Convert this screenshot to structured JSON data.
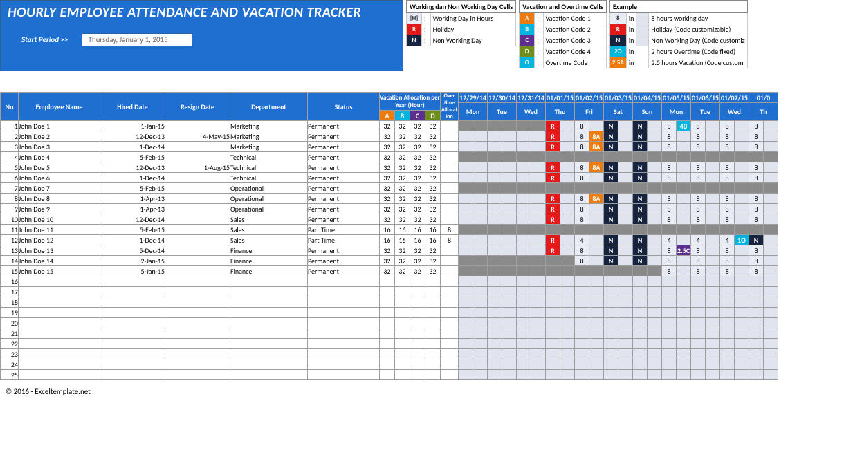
{
  "title": "HOURLY EMPLOYEE ATTENDANCE AND VACATION TRACKER",
  "start_label": "Start Period >>",
  "start_value": "Thursday, January 1, 2015",
  "legend1": {
    "header": "Working dan Non Working Day Cells",
    "rows": [
      {
        "code": "[H]",
        "cls": "lg-h",
        "desc": "Working Day in Hours"
      },
      {
        "code": "R",
        "cls": "lg-r",
        "desc": "Holiday"
      },
      {
        "code": "N",
        "cls": "lg-n",
        "desc": "Non Working Day"
      }
    ]
  },
  "legend2": {
    "header": "Vacation and Overtime Cells",
    "rows": [
      {
        "code": "A",
        "cls": "lg-a",
        "desc": "Vacation Code 1"
      },
      {
        "code": "B",
        "cls": "lg-b",
        "desc": "Vacation Code 2"
      },
      {
        "code": "C",
        "cls": "lg-c",
        "desc": "Vacation Code 3"
      },
      {
        "code": "D",
        "cls": "lg-d",
        "desc": "Vacation Code 4"
      },
      {
        "code": "O",
        "cls": "lg-o",
        "desc": "Overtime Code"
      }
    ]
  },
  "legend3": {
    "header": "Example",
    "rows": [
      {
        "code": "8",
        "cls": "lg-num",
        "in": "in",
        "box": "ltgray",
        "desc": "8 hours working day"
      },
      {
        "code": "R",
        "cls": "lg-r",
        "in": "in",
        "box": "ltgray",
        "desc": "Holiday (Code customizable)"
      },
      {
        "code": "N",
        "cls": "lg-n",
        "in": "in",
        "box": "ltgray",
        "desc": "Non Working Day (Code customiz"
      },
      {
        "code": "2O",
        "cls": "lg-2o",
        "in": "in",
        "box": "",
        "desc": "2 hours Overtime (Code fixed)"
      },
      {
        "code": "2.5A",
        "cls": "lg-25a",
        "in": "in",
        "box": "",
        "desc": "2.5 hours Vacation (Code custom"
      }
    ]
  },
  "headers": {
    "no": "No",
    "name": "Employee Name",
    "hired": "Hired Date",
    "resign": "Resign Date",
    "dept": "Department",
    "status": "Status",
    "vac": "Vacation Allocation per Year (Hour)",
    "ot": "Over time Allocat ion",
    "vac_sub": [
      "A",
      "B",
      "C",
      "D"
    ],
    "dates": [
      "12/29/14",
      "12/30/14",
      "12/31/14",
      "01/01/15",
      "01/02/15",
      "01/03/15",
      "01/04/15",
      "01/05/15",
      "01/06/15",
      "01/07/15",
      "01/0"
    ],
    "days": [
      "Mon",
      "Tue",
      "Wed",
      "Thu",
      "Fri",
      "Sat",
      "Sun",
      "Mon",
      "Tue",
      "Wed",
      "Th"
    ]
  },
  "rows": [
    {
      "no": 1,
      "name": "John Doe 1",
      "hired": "1-Jan-15",
      "resign": "",
      "dept": "Marketing",
      "status": "Permanent",
      "vac": [
        32,
        32,
        32,
        32
      ],
      "ot": "",
      "days": [
        [
          "g",
          ""
        ],
        [
          "g",
          ""
        ],
        [
          "g",
          ""
        ],
        [
          "R",
          ""
        ],
        [
          "8",
          ""
        ],
        [
          "N",
          ""
        ],
        [
          "N",
          ""
        ],
        [
          "8",
          "4B"
        ],
        [
          "8",
          ""
        ],
        [
          "8",
          ""
        ],
        [
          "8",
          ""
        ]
      ]
    },
    {
      "no": 2,
      "name": "John Doe 2",
      "hired": "12-Dec-13",
      "resign": "4-May-15",
      "dept": "Marketing",
      "status": "Permanent",
      "vac": [
        32,
        32,
        32,
        32
      ],
      "ot": "",
      "days": [
        [
          "",
          ""
        ],
        [
          "",
          ""
        ],
        [
          "",
          ""
        ],
        [
          "R",
          ""
        ],
        [
          "8",
          "8A"
        ],
        [
          "N",
          ""
        ],
        [
          "N",
          ""
        ],
        [
          "8",
          ""
        ],
        [
          "8",
          ""
        ],
        [
          "8",
          ""
        ],
        [
          "8",
          ""
        ]
      ]
    },
    {
      "no": 3,
      "name": "John Doe 3",
      "hired": "1-Dec-14",
      "resign": "",
      "dept": "Marketing",
      "status": "Permanent",
      "vac": [
        32,
        32,
        32,
        32
      ],
      "ot": "",
      "days": [
        [
          "",
          ""
        ],
        [
          "",
          ""
        ],
        [
          "",
          ""
        ],
        [
          "R",
          ""
        ],
        [
          "8",
          "8A"
        ],
        [
          "N",
          ""
        ],
        [
          "N",
          ""
        ],
        [
          "8",
          ""
        ],
        [
          "8",
          ""
        ],
        [
          "8",
          ""
        ],
        [
          "8",
          ""
        ]
      ]
    },
    {
      "no": 4,
      "name": "John Doe 4",
      "hired": "5-Feb-15",
      "resign": "",
      "dept": "Technical",
      "status": "Permanent",
      "vac": [
        32,
        32,
        32,
        32
      ],
      "ot": "",
      "days": [
        [
          "g",
          ""
        ],
        [
          "g",
          ""
        ],
        [
          "g",
          ""
        ],
        [
          "g",
          ""
        ],
        [
          "g",
          ""
        ],
        [
          "g",
          ""
        ],
        [
          "g",
          ""
        ],
        [
          "g",
          ""
        ],
        [
          "g",
          ""
        ],
        [
          "g",
          ""
        ],
        [
          "g",
          ""
        ]
      ]
    },
    {
      "no": 5,
      "name": "John Doe 5",
      "hired": "12-Dec-13",
      "resign": "1-Aug-15",
      "dept": "Technical",
      "status": "Permanent",
      "vac": [
        32,
        32,
        32,
        32
      ],
      "ot": "",
      "days": [
        [
          "",
          ""
        ],
        [
          "",
          ""
        ],
        [
          "",
          ""
        ],
        [
          "R",
          ""
        ],
        [
          "8",
          "8A"
        ],
        [
          "N",
          ""
        ],
        [
          "N",
          ""
        ],
        [
          "8",
          ""
        ],
        [
          "8",
          ""
        ],
        [
          "8",
          ""
        ],
        [
          "8",
          ""
        ]
      ]
    },
    {
      "no": 6,
      "name": "John Doe 6",
      "hired": "1-Dec-14",
      "resign": "",
      "dept": "Technical",
      "status": "Permanent",
      "vac": [
        32,
        32,
        32,
        32
      ],
      "ot": "",
      "days": [
        [
          "",
          ""
        ],
        [
          "",
          ""
        ],
        [
          "",
          ""
        ],
        [
          "R",
          ""
        ],
        [
          "8",
          ""
        ],
        [
          "N",
          ""
        ],
        [
          "N",
          ""
        ],
        [
          "8",
          ""
        ],
        [
          "8",
          ""
        ],
        [
          "8",
          ""
        ],
        [
          "8",
          ""
        ]
      ]
    },
    {
      "no": 7,
      "name": "John Doe 7",
      "hired": "5-Feb-15",
      "resign": "",
      "dept": "Operational",
      "status": "Permanent",
      "vac": [
        32,
        32,
        32,
        32
      ],
      "ot": "",
      "days": [
        [
          "g",
          ""
        ],
        [
          "g",
          ""
        ],
        [
          "g",
          ""
        ],
        [
          "g",
          ""
        ],
        [
          "g",
          ""
        ],
        [
          "g",
          ""
        ],
        [
          "g",
          ""
        ],
        [
          "g",
          ""
        ],
        [
          "g",
          ""
        ],
        [
          "g",
          ""
        ],
        [
          "g",
          ""
        ]
      ]
    },
    {
      "no": 8,
      "name": "John Doe 8",
      "hired": "1-Apr-13",
      "resign": "",
      "dept": "Operational",
      "status": "Permanent",
      "vac": [
        32,
        32,
        32,
        32
      ],
      "ot": "",
      "days": [
        [
          "",
          ""
        ],
        [
          "",
          ""
        ],
        [
          "",
          ""
        ],
        [
          "R",
          ""
        ],
        [
          "8",
          "8A"
        ],
        [
          "N",
          ""
        ],
        [
          "N",
          ""
        ],
        [
          "8",
          ""
        ],
        [
          "8",
          ""
        ],
        [
          "8",
          ""
        ],
        [
          "8",
          ""
        ]
      ]
    },
    {
      "no": 9,
      "name": "John Doe 9",
      "hired": "1-Apr-13",
      "resign": "",
      "dept": "Operational",
      "status": "Permanent",
      "vac": [
        32,
        32,
        32,
        32
      ],
      "ot": "",
      "days": [
        [
          "",
          ""
        ],
        [
          "",
          ""
        ],
        [
          "",
          ""
        ],
        [
          "R",
          ""
        ],
        [
          "8",
          ""
        ],
        [
          "N",
          ""
        ],
        [
          "N",
          ""
        ],
        [
          "8",
          ""
        ],
        [
          "8",
          ""
        ],
        [
          "8",
          ""
        ],
        [
          "8",
          ""
        ]
      ]
    },
    {
      "no": 10,
      "name": "John Doe 10",
      "hired": "12-Dec-14",
      "resign": "",
      "dept": "Sales",
      "status": "Permanent",
      "vac": [
        32,
        32,
        32,
        32
      ],
      "ot": "",
      "days": [
        [
          "",
          ""
        ],
        [
          "",
          ""
        ],
        [
          "",
          ""
        ],
        [
          "R",
          ""
        ],
        [
          "8",
          ""
        ],
        [
          "N",
          ""
        ],
        [
          "N",
          ""
        ],
        [
          "8",
          ""
        ],
        [
          "8",
          ""
        ],
        [
          "8",
          ""
        ],
        [
          "8",
          ""
        ]
      ]
    },
    {
      "no": 11,
      "name": "John Doe 11",
      "hired": "5-Feb-15",
      "resign": "",
      "dept": "Sales",
      "status": "Part Time",
      "vac": [
        16,
        16,
        16,
        16
      ],
      "ot": "8",
      "days": [
        [
          "g",
          ""
        ],
        [
          "g",
          ""
        ],
        [
          "g",
          ""
        ],
        [
          "g",
          ""
        ],
        [
          "g",
          ""
        ],
        [
          "g",
          ""
        ],
        [
          "g",
          ""
        ],
        [
          "g",
          ""
        ],
        [
          "g",
          ""
        ],
        [
          "g",
          ""
        ],
        [
          "g",
          ""
        ]
      ]
    },
    {
      "no": 12,
      "name": "John Doe 12",
      "hired": "1-Dec-14",
      "resign": "",
      "dept": "Sales",
      "status": "Part Time",
      "vac": [
        16,
        16,
        16,
        16
      ],
      "ot": "8",
      "days": [
        [
          "",
          ""
        ],
        [
          "",
          ""
        ],
        [
          "",
          ""
        ],
        [
          "R",
          ""
        ],
        [
          "4",
          ""
        ],
        [
          "N",
          ""
        ],
        [
          "N",
          ""
        ],
        [
          "4",
          ""
        ],
        [
          "4",
          ""
        ],
        [
          "4",
          "1O"
        ],
        [
          "N",
          ""
        ]
      ]
    },
    {
      "no": 13,
      "name": "John Doe 13",
      "hired": "5-Dec-14",
      "resign": "",
      "dept": "Finance",
      "status": "Permanent",
      "vac": [
        32,
        32,
        32,
        32
      ],
      "ot": "",
      "days": [
        [
          "",
          ""
        ],
        [
          "",
          ""
        ],
        [
          "",
          ""
        ],
        [
          "R",
          ""
        ],
        [
          "8",
          ""
        ],
        [
          "N",
          ""
        ],
        [
          "N",
          ""
        ],
        [
          "8",
          "2.5C"
        ],
        [
          "8",
          ""
        ],
        [
          "8",
          ""
        ],
        [
          "8",
          ""
        ]
      ]
    },
    {
      "no": 14,
      "name": "John Doe 14",
      "hired": "2-Jan-15",
      "resign": "",
      "dept": "Finance",
      "status": "Permanent",
      "vac": [
        32,
        32,
        32,
        32
      ],
      "ot": "",
      "days": [
        [
          "g",
          ""
        ],
        [
          "g",
          ""
        ],
        [
          "g",
          ""
        ],
        [
          "g",
          ""
        ],
        [
          "8",
          ""
        ],
        [
          "N",
          ""
        ],
        [
          "N",
          ""
        ],
        [
          "8",
          ""
        ],
        [
          "8",
          ""
        ],
        [
          "8",
          ""
        ],
        [
          "8",
          ""
        ]
      ]
    },
    {
      "no": 15,
      "name": "John Doe 15",
      "hired": "5-Jan-15",
      "resign": "",
      "dept": "Finance",
      "status": "Permanent",
      "vac": [
        32,
        32,
        32,
        32
      ],
      "ot": "",
      "days": [
        [
          "g",
          ""
        ],
        [
          "g",
          ""
        ],
        [
          "g",
          ""
        ],
        [
          "g",
          ""
        ],
        [
          "g",
          ""
        ],
        [
          "g",
          ""
        ],
        [
          "g",
          ""
        ],
        [
          "8",
          ""
        ],
        [
          "8",
          ""
        ],
        [
          "8",
          ""
        ],
        [
          "8",
          ""
        ]
      ]
    }
  ],
  "empty_rows": [
    16,
    17,
    18,
    19,
    20,
    21,
    22,
    23,
    24,
    25
  ],
  "footer": "© 2016 - Exceltemplate.net"
}
